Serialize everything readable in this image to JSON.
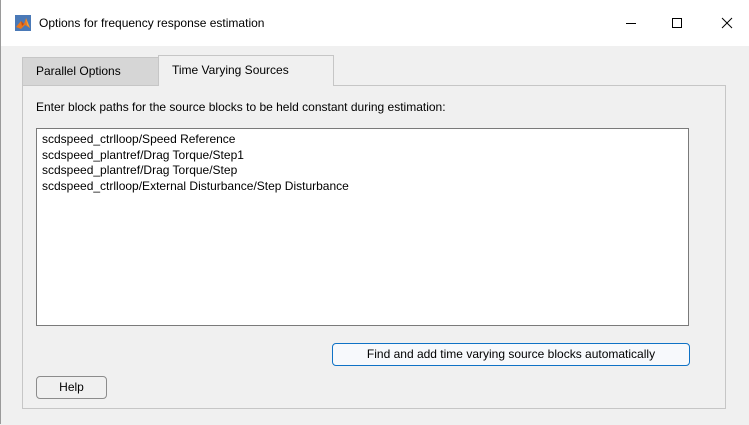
{
  "window": {
    "title": "Options for frequency response estimation",
    "controls": {
      "minimize": "minimize-icon",
      "maximize": "maximize-icon",
      "close": "close-icon"
    }
  },
  "tabs": [
    {
      "label": "Parallel Options",
      "active": false
    },
    {
      "label": "Time Varying Sources",
      "active": true
    }
  ],
  "panel": {
    "instruction": "Enter block paths for the source blocks to be held constant during estimation:",
    "paths": [
      "scdspeed_ctrlloop/Speed Reference",
      "scdspeed_plantref/Drag Torque/Step1",
      "scdspeed_plantref/Drag Torque/Step",
      "scdspeed_ctrlloop/External Disturbance/Step Disturbance"
    ],
    "find_button_label": "Find and add time varying source blocks automatically",
    "help_button_label": "Help"
  },
  "colors": {
    "accent": "#0f72c6",
    "window_bg": "#f0f0f0"
  }
}
